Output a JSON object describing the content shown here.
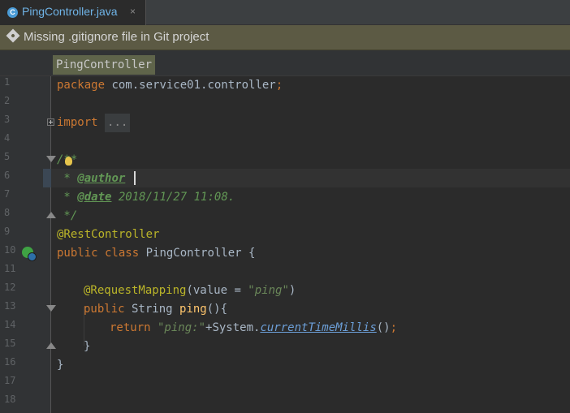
{
  "tab": {
    "icon_letter": "C",
    "filename": "PingController.java",
    "close": "×"
  },
  "banner": {
    "message": "Missing .gitignore file in Git project"
  },
  "breadcrumb": {
    "item": "PingController"
  },
  "line_numbers": [
    "1",
    "2",
    "3",
    "4",
    "5",
    "6",
    "7",
    "8",
    "9",
    "10",
    "11",
    "12",
    "13",
    "14",
    "15",
    "16",
    "17",
    "18"
  ],
  "code": {
    "l1_kw": "package",
    "l1_pkg": " com.service01.controller",
    "l1_semi": ";",
    "l3_kw": "import",
    "l3_fold": "...",
    "l6": "/**",
    "l7_star": " * ",
    "l7_tag": "@author",
    "l8_star": " * ",
    "l8_tag": "@date",
    "l8_text": " 2018/11/27 11:08.",
    "l9": " */",
    "l10": "@RestController",
    "l11_kw": "public class",
    "l11_rest": " PingController {",
    "l13_ann": "@RequestMapping",
    "l13_open": "(value = ",
    "l13_str": "\"ping\"",
    "l13_close": ")",
    "l14_kw": "public",
    "l14_type": " String ",
    "l14_name": "ping",
    "l14_rest": "(){",
    "l15_kw": "return",
    "l15_str": " \"ping:\"",
    "l15_plus": "+System.",
    "l15_call": "currentTimeMillis",
    "l15_paren": "()",
    "l15_semi": ";",
    "l16": "}",
    "l17": "}"
  }
}
